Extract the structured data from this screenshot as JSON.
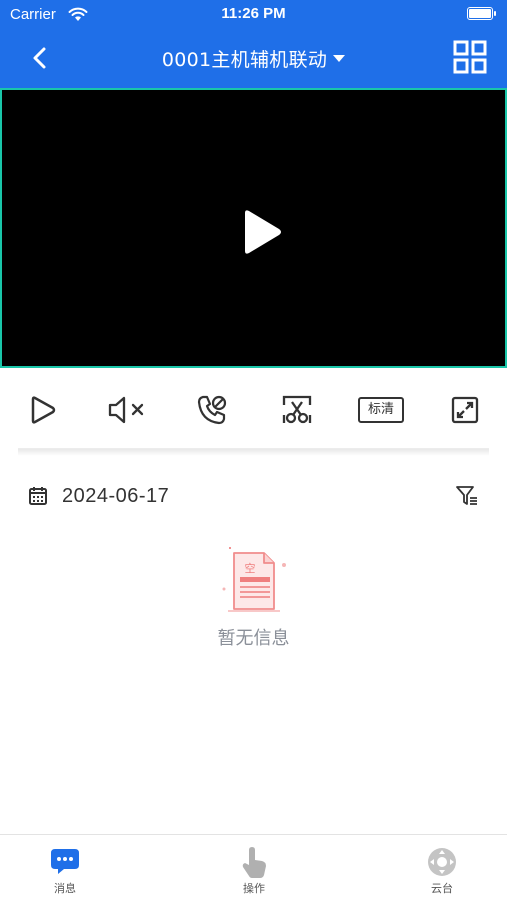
{
  "status_bar": {
    "carrier": "Carrier",
    "time": "11:26 PM"
  },
  "header": {
    "title": "0001主机辅机联动",
    "back_icon": "chevron-left-icon",
    "menu_icon": "grid-icon"
  },
  "video": {
    "play_icon": "play-icon"
  },
  "controls": {
    "items": [
      {
        "name": "play",
        "icon": "play-outline-icon"
      },
      {
        "name": "mute",
        "icon": "speaker-muted-icon"
      },
      {
        "name": "intercom",
        "icon": "phone-icon"
      },
      {
        "name": "screenshot",
        "icon": "scissors-icon"
      },
      {
        "name": "quality",
        "label": "标清"
      },
      {
        "name": "fullscreen",
        "icon": "fullscreen-icon"
      }
    ]
  },
  "filter": {
    "date": "2024-06-17",
    "calendar_icon": "calendar-icon",
    "filter_icon": "filter-icon"
  },
  "empty_state": {
    "text": "暂无信息",
    "icon_char": "空"
  },
  "tabbar": {
    "tabs": [
      {
        "label": "消息",
        "icon": "chat-icon",
        "active": true
      },
      {
        "label": "操作",
        "icon": "hand-pointer-icon",
        "active": false
      },
      {
        "label": "云台",
        "icon": "ptz-control-icon",
        "active": false
      }
    ]
  },
  "colors": {
    "primary": "#1f6fe8",
    "video_border": "#19c6a9",
    "inactive": "#9a9a9a",
    "empty_accent": "#f08c8c"
  }
}
